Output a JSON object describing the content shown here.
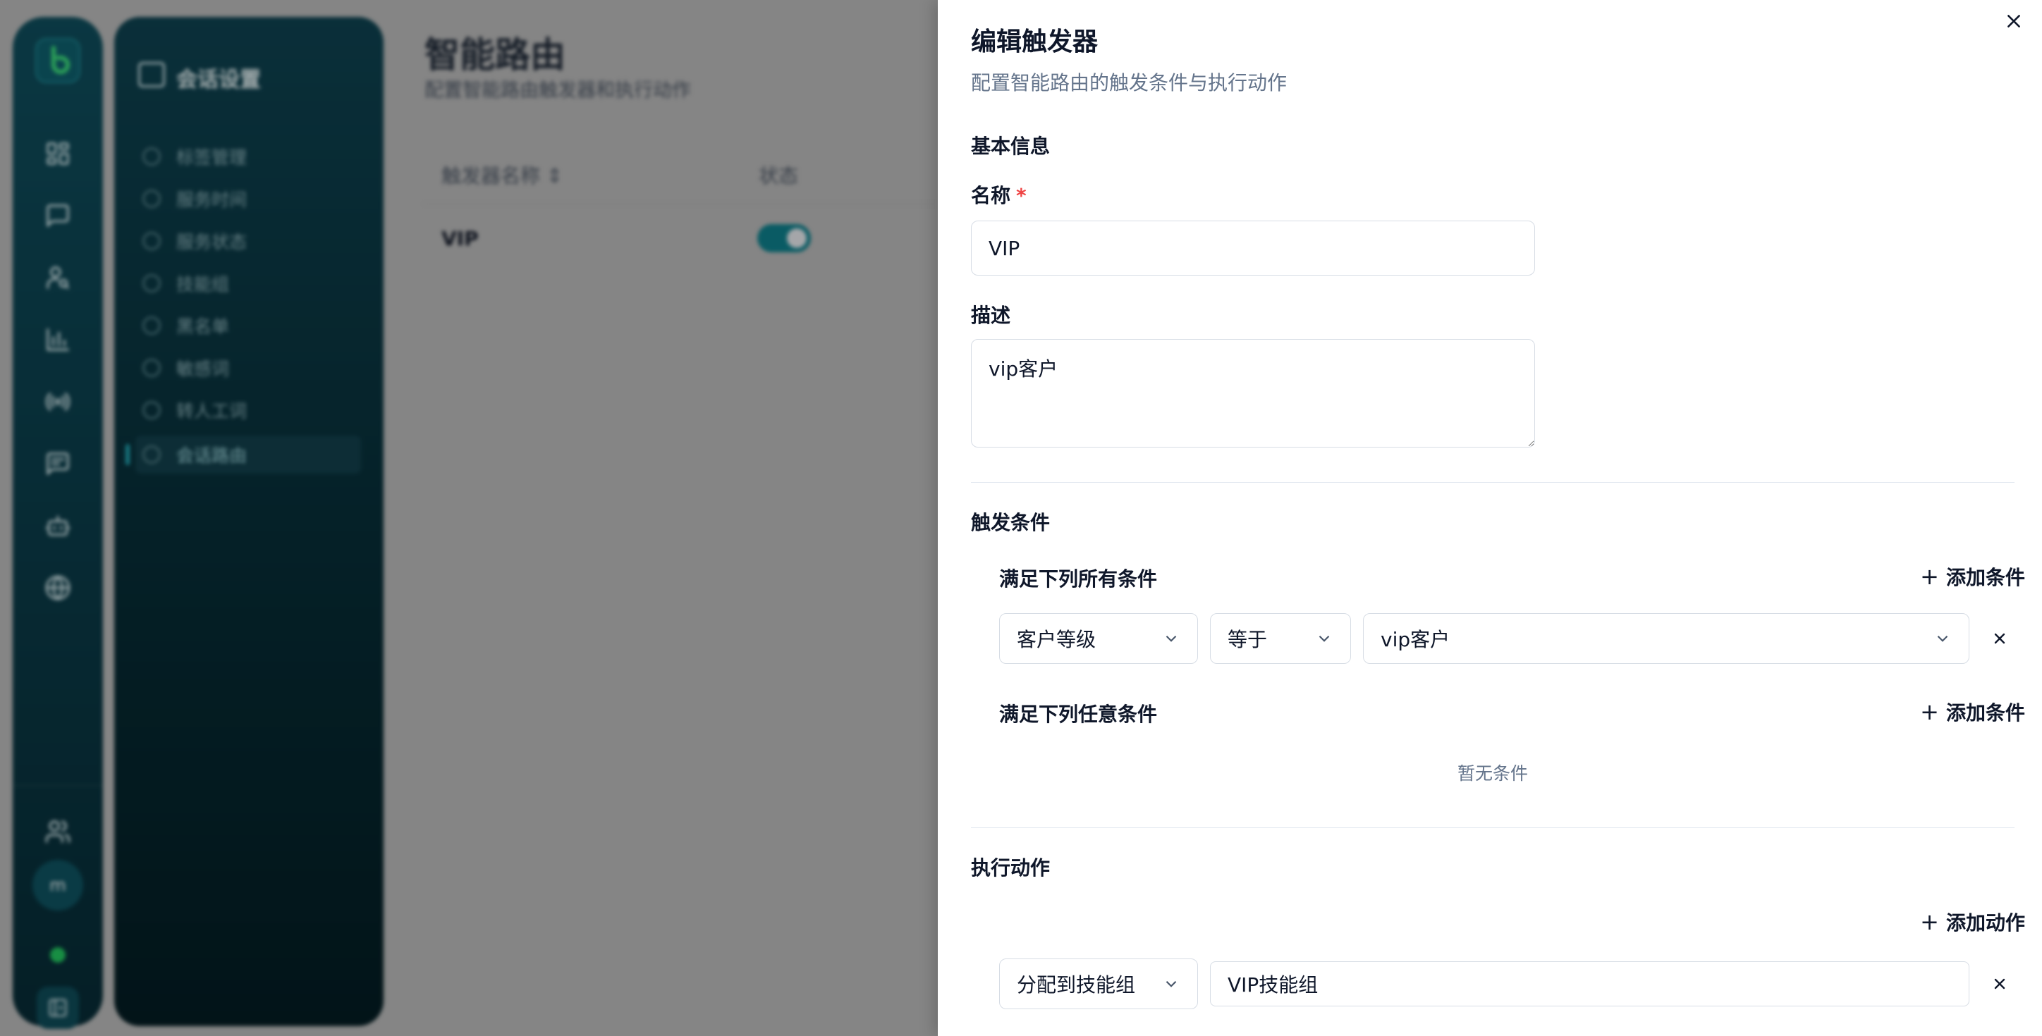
{
  "background": {
    "subnav": {
      "title": "会话设置",
      "items": [
        {
          "label": "标签管理"
        },
        {
          "label": "服务时间"
        },
        {
          "label": "服务状态"
        },
        {
          "label": "技能组"
        },
        {
          "label": "黑名单"
        },
        {
          "label": "敏感词"
        },
        {
          "label": "转人工词"
        },
        {
          "label": "会话路由",
          "active": true
        }
      ]
    },
    "page": {
      "title": "智能路由",
      "subtitle": "配置智能路由触发器和执行动作",
      "columns": [
        "触发器名称",
        "状态"
      ],
      "rows": [
        {
          "name": "VIP",
          "enabled": true
        }
      ]
    },
    "avatar_initial": "m",
    "rail_icons": [
      "dashboard-icon",
      "chat-icon",
      "user-search-icon",
      "bar-chart-icon",
      "broadcast-icon",
      "message-square-icon",
      "bot-icon",
      "globe-icon",
      "team-icon",
      "sidebar-collapse-icon"
    ],
    "accent": "#0e7f8b",
    "status_color": "#22c55e"
  },
  "drawer": {
    "title": "编辑触发器",
    "subtitle": "配置智能路由的触发条件与执行动作",
    "basic_info": {
      "section_label": "基本信息",
      "name_label": "名称",
      "name_required_mark": "*",
      "name_value": "VIP",
      "desc_label": "描述",
      "desc_value": "vip客户"
    },
    "conditions": {
      "section_label": "触发条件",
      "all_group": {
        "label": "满足下列所有条件",
        "add_label": "添加条件",
        "rows": [
          {
            "field": "客户等级",
            "operator": "等于",
            "value": "vip客户"
          }
        ]
      },
      "any_group": {
        "label": "满足下列任意条件",
        "add_label": "添加条件",
        "empty_text": "暂无条件"
      }
    },
    "actions": {
      "section_label": "执行动作",
      "add_label": "添加动作",
      "rows": [
        {
          "type": "分配到技能组",
          "value": "VIP技能组"
        }
      ]
    }
  }
}
